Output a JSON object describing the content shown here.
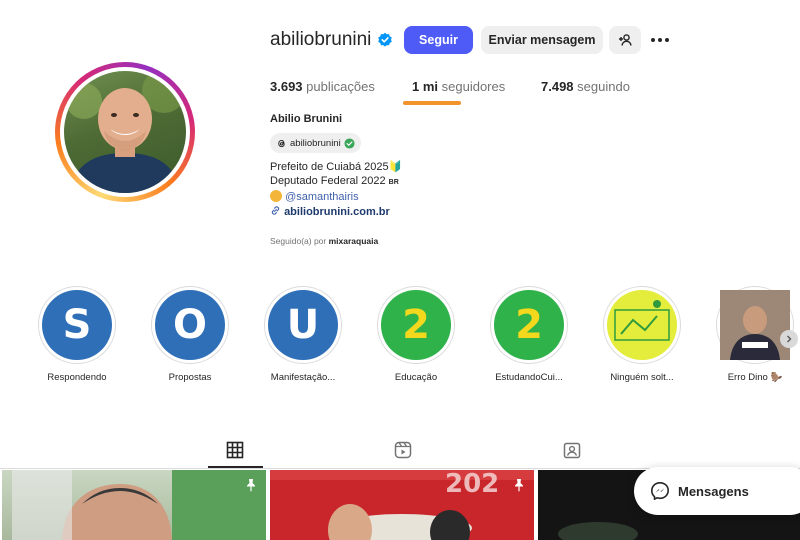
{
  "profile": {
    "username": "abiliobrunini",
    "full_name": "Abilio Brunini",
    "threads_handle": "abiliobrunini",
    "follow_label": "Seguir",
    "message_label": "Enviar mensagem"
  },
  "stats": {
    "posts_count": "3.693",
    "posts_label": "publicações",
    "followers_count": "1 mi",
    "followers_label": "seguidores",
    "following_count": "7.498",
    "following_label": "seguindo"
  },
  "bio": {
    "line1": "Prefeito de Cuiabá 2025🔰",
    "line2": "Deputado Federal 2022",
    "line2_flag": "BR",
    "mention": "@samanthairis",
    "link": "abiliobrunini.com.br",
    "followed_by_prefix": "Seguido(a) por",
    "followed_by_user": "mixaraquaia"
  },
  "highlights": [
    {
      "letter": "S",
      "label": "Respondendo",
      "bg": "#2f6fb8",
      "fg": "#ffffff"
    },
    {
      "letter": "O",
      "label": "Propostas",
      "bg": "#2f6fb8",
      "fg": "#ffffff"
    },
    {
      "letter": "U",
      "label": "Manifestação...",
      "bg": "#2f6fb8",
      "fg": "#ffffff"
    },
    {
      "letter": "2",
      "label": "Educação",
      "bg": "#2fb24a",
      "fg": "#f3d81d"
    },
    {
      "letter": "2",
      "label": "EstudandoCui...",
      "bg": "#2fb24a",
      "fg": "#f3d81d"
    },
    {
      "letter": "",
      "label": "Ninguém solt...",
      "bg": "#e4ec3c",
      "fg": "#2f9b3c"
    },
    {
      "letter": "",
      "label": "Erro Dino 🦫",
      "bg": "#8a7060",
      "fg": "#ffffff"
    }
  ],
  "messages": {
    "label": "Mensagens"
  },
  "colors": {
    "follow_button": "#4f5bf7",
    "accent_underline": "#f2932c",
    "verified": "#0095f6"
  }
}
